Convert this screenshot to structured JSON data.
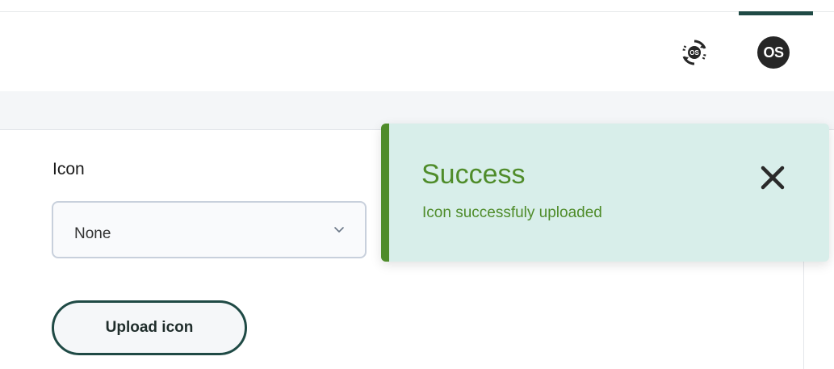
{
  "header": {
    "actions": [
      {
        "name": "sync-icon"
      },
      {
        "name": "os-badge",
        "label": "OS"
      }
    ],
    "accent_color": "#1f4a45"
  },
  "form": {
    "icon_label": "Icon",
    "icon_select": {
      "value": "None"
    },
    "upload_button_label": "Upload icon"
  },
  "toast": {
    "title": "Success",
    "message": "Icon successfuly uploaded",
    "accent_color": "#4f8c2a",
    "background_color": "#d8eeea"
  }
}
